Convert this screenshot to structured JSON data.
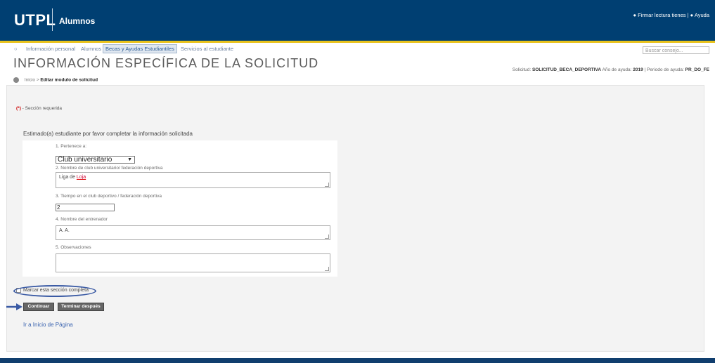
{
  "header": {
    "logo": "UTPL",
    "subtitle": "Alumnos",
    "links": [
      "Firmar lectura tienes",
      "Ayuda"
    ]
  },
  "nav": {
    "items": [
      {
        "label": "Información personal",
        "active": false
      },
      {
        "label": "Alumnos",
        "active": false
      },
      {
        "label": "Becas y Ayudas Estudiantiles",
        "active": true
      },
      {
        "label": "Servicios al estudiante",
        "active": false
      }
    ],
    "search_placeholder": "Buscar consejo..."
  },
  "page": {
    "title": "INFORMACIÓN ESPECÍFICA DE LA SOLICITUD",
    "breadcrumb_home": "Inicio",
    "breadcrumb_current": "Editar modulo de solicitud",
    "request_label": "Solicitud:",
    "request_value": "SOLICITUD_BECA_DEPORTIVA",
    "year_label": "Año de ayuda:",
    "year_value": "2019",
    "period_label": "Periodo de ayuda:",
    "period_value": "PR_DO_FE"
  },
  "form": {
    "required_star": "(*)",
    "required_text": "- Sección requerida",
    "intro": "Estimado(a) estudiante por favor completar la información solicitada",
    "q1_label": "1. Pertenece a:",
    "q1_value": "Club universitario",
    "q2_label": "2. Nombre de club universitario/ federación deportiva",
    "q2_value_a": "Liga de ",
    "q2_value_b": "Loja",
    "q3_label": "3. Tiempo en el club deportivo / federación deportiva",
    "q3_value": "2",
    "q4_label": "4. Nombre del entrenador",
    "q4_value": "A. A.",
    "q5_label": "5. Observaciones",
    "q5_value": "",
    "complete_checkbox_label": "Marcar esta sección completa",
    "continue_button": "Continuar",
    "finish_button": "Terminar después",
    "top_link": "Ir a Inicio de Página"
  },
  "colors": {
    "header_bg": "#003f72",
    "header_accent": "#e8c21c",
    "link": "#3b64b0",
    "annotation": "#3a5aa4"
  }
}
